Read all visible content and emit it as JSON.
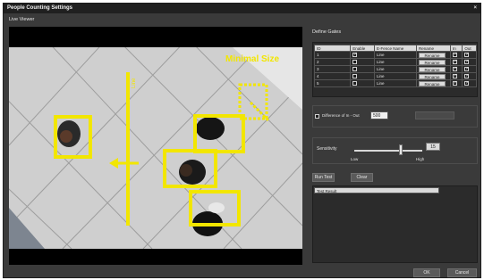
{
  "window": {
    "title": "People Counting Settings",
    "close_glyph": "×"
  },
  "viewer": {
    "label": "Live Viewer",
    "line_label": "Line",
    "min_size_label": "Minimal Size"
  },
  "gates": {
    "label": "Define Gates",
    "columns": [
      "ID",
      "Enable",
      "E-Fence Name",
      "Rename",
      "In",
      "Out"
    ],
    "rows": [
      {
        "id": "1",
        "enable": true,
        "name": "Line",
        "rename": "Rename",
        "in": true,
        "out": true
      },
      {
        "id": "2",
        "enable": false,
        "name": "Line",
        "rename": "Rename",
        "in": true,
        "out": true
      },
      {
        "id": "3",
        "enable": false,
        "name": "Line",
        "rename": "Rename",
        "in": true,
        "out": true
      },
      {
        "id": "4",
        "enable": false,
        "name": "Line",
        "rename": "Rename",
        "in": true,
        "out": true
      },
      {
        "id": "5",
        "enable": false,
        "name": "Line",
        "rename": "Rename",
        "in": true,
        "out": true
      }
    ]
  },
  "difference": {
    "label": "Difference of In - Out",
    "checked": false,
    "value": "500"
  },
  "sensitivity": {
    "label": "Sensitivity",
    "value": "15",
    "level_fraction": 0.68,
    "low": "Low",
    "high": "High"
  },
  "actions": {
    "run_test": "Run Test",
    "clear": "Clear"
  },
  "result": {
    "header": "Test Result"
  },
  "footer": {
    "ok": "OK",
    "cancel": "Cancel"
  },
  "colors": {
    "overlay": "#f2e600",
    "window_bg": "#3a3a3a",
    "titlebar": "#202020"
  }
}
